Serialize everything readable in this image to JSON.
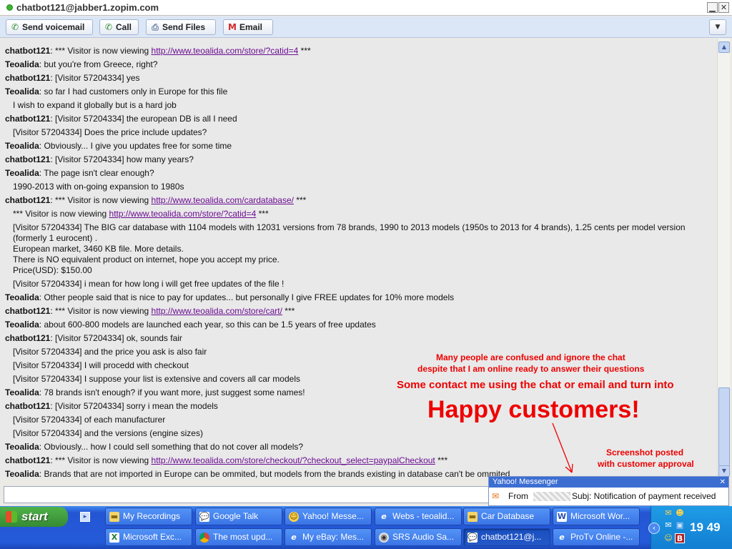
{
  "window": {
    "title": "chatbot121@jabber1.zopim.com",
    "minimize_glyph": "▁",
    "close_glyph": "✕"
  },
  "toolbar": {
    "buttons": [
      {
        "label": "Send voicemail",
        "icon": "phone-icon"
      },
      {
        "label": "Call",
        "icon": "phone-icon"
      },
      {
        "label": "Send Files",
        "icon": "printer-icon"
      },
      {
        "label": "Email",
        "icon": "gmail-icon"
      }
    ],
    "menu_glyph": "▼"
  },
  "chat": {
    "messages": [
      {
        "nick": "chatbot121",
        "text": ": *** Visitor is now viewing ",
        "link": "http://www.teoalida.com/store/?catid=4",
        "suffix": " ***"
      },
      {
        "nick": "Teoalida",
        "text": ": but you're from Greece, right?"
      },
      {
        "nick": "chatbot121",
        "text": ": [Visitor 57204334] yes"
      },
      {
        "nick": "Teoalida",
        "text": ": so far I had customers only in Europe for this file"
      },
      {
        "text": "I wish to expand it globally but is a hard job"
      },
      {
        "nick": "chatbot121",
        "text": ": [Visitor 57204334] the european DB is all I need"
      },
      {
        "text": "[Visitor 57204334] Does the price include updates?"
      },
      {
        "nick": "Teoalida",
        "text": ": Obviously... I give you updates free for some time"
      },
      {
        "nick": "chatbot121",
        "text": ": [Visitor 57204334] how many years?"
      },
      {
        "nick": "Teoalida",
        "text": ": The page isn't clear enough?"
      },
      {
        "text": "1990-2013 with on-going expansion to 1980s"
      },
      {
        "nick": "chatbot121",
        "text": ": *** Visitor is now viewing ",
        "link": "http://www.teoalida.com/cardatabase/",
        "suffix": " ***"
      },
      {
        "text": "*** Visitor is now viewing ",
        "link": "http://www.teoalida.com/store/?catid=4",
        "suffix": " ***"
      },
      {
        "text": "[Visitor 57204334] The BIG car database with 1104 models with 12031 versions from 78 brands, 1990 to 2013 models (1950s to 2013 for 4 brands), 1.25 cents per model version (formerly 1 eurocent) .\nEuropean market, 3460 KB file. More details.\nThere is NO equivalent product on internet, hope you accept my price.\nPrice(USD): $150.00"
      },
      {
        "text": "[Visitor 57204334] i mean for how long i will get free updates of the file !"
      },
      {
        "nick": "Teoalida",
        "text": ": Other people said that is nice to pay for updates... but personally I give FREE updates for 10% more models"
      },
      {
        "nick": "chatbot121",
        "text": ": *** Visitor is now viewing ",
        "link": "http://www.teoalida.com/store/cart/",
        "suffix": " ***"
      },
      {
        "nick": "Teoalida",
        "text": ": about 600-800 models are launched each year, so this can be 1.5 years of free updates"
      },
      {
        "nick": "chatbot121",
        "text": ": [Visitor 57204334] ok, sounds fair"
      },
      {
        "text": "[Visitor 57204334] and the price you ask is also fair"
      },
      {
        "text": "[Visitor 57204334] I will procedd with checkout"
      },
      {
        "text": "[Visitor 57204334] I suppose your list is extensive and covers all car models"
      },
      {
        "nick": "Teoalida",
        "text": ": 78 brands isn't enough? if you want more, just suggest some names!"
      },
      {
        "nick": "chatbot121",
        "text": ": [Visitor 57204334] sorry i mean the models"
      },
      {
        "text": "[Visitor 57204334] of each manufacturer"
      },
      {
        "text": "[Visitor 57204334] and the versions (engine sizes)"
      },
      {
        "nick": "Teoalida",
        "text": ": Obviously... how I could sell something that do not cover all models?"
      },
      {
        "nick": "chatbot121",
        "text": ": *** Visitor is now viewing ",
        "link": "http://www.teoalida.com/store/checkout/?checkout_select=paypalCheckout",
        "suffix": " ***"
      },
      {
        "nick": "Teoalida",
        "text": ": Brands that are not imported in Europe can be ommited, but models from the brands existing in database can't be ommited"
      }
    ]
  },
  "annotations": {
    "line1": "Many people are confused and ignore the chat",
    "line2": "despite that I am online ready to answer their questions",
    "line3": "Some contact me using the chat or email and turn into",
    "headline": "Happy customers!",
    "note1": "Screenshot posted",
    "note2": "with customer approval",
    "color": "#e00000"
  },
  "notification": {
    "title": "Yahoo! Messenger",
    "from_label": "From",
    "subject": "Subj: Notification of payment received",
    "close_glyph": "✕"
  },
  "taskbar": {
    "start_label": "start",
    "row1": [
      {
        "label": "My Recordings",
        "icon": "folder-icon"
      },
      {
        "label": "Google Talk",
        "icon": "chat-bubble-icon"
      },
      {
        "label": "Yahoo! Messe...",
        "icon": "yahoo-messenger-icon"
      },
      {
        "label": "Webs - teoalid...",
        "icon": "internet-explorer-icon"
      },
      {
        "label": "Car Database",
        "icon": "folder-icon"
      },
      {
        "label": "Microsoft Wor...",
        "icon": "word-icon"
      }
    ],
    "row2": [
      {
        "label": "Microsoft Exc...",
        "icon": "excel-icon"
      },
      {
        "label": "The most upd...",
        "icon": "chrome-icon"
      },
      {
        "label": "My eBay: Mes...",
        "icon": "internet-explorer-icon"
      },
      {
        "label": "SRS Audio Sa...",
        "icon": "audio-icon"
      },
      {
        "label": "chatbot121@j...",
        "icon": "chat-bubble-icon"
      },
      {
        "label": "ProTv Online -...",
        "icon": "internet-explorer-icon"
      }
    ],
    "clock": "19 49"
  }
}
